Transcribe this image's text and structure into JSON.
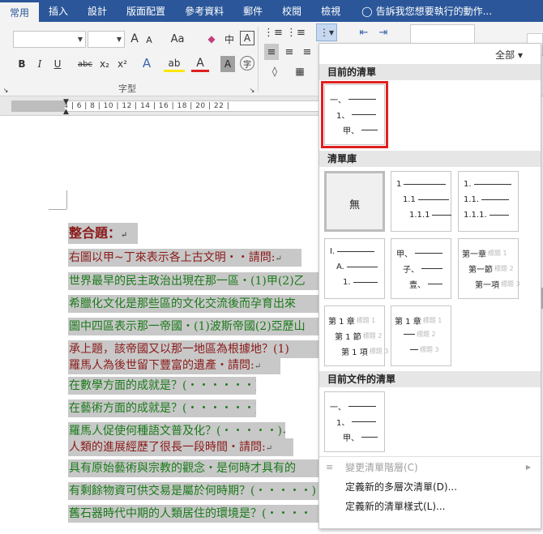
{
  "tabs": [
    "常用",
    "插入",
    "設計",
    "版面配置",
    "參考資料",
    "郵件",
    "校閱",
    "檢視"
  ],
  "tell_me": "告訴我您想要執行的動作...",
  "ribbon": {
    "font_group_label": "字型",
    "grow_font": "A",
    "shrink_font": "A",
    "change_case": "Aa",
    "phonetic": "中",
    "border_char": "A",
    "bold": "B",
    "italic": "I",
    "underline": "U",
    "strike": "abc",
    "sub": "x₂",
    "sup": "x²",
    "char_shade": "A"
  },
  "ruler_text": "| 4 | 2 |   | 2 | 4 | 6 | 8 | 10 | 12 | 14 | 16 | 18 | 20 | 22 |",
  "document": {
    "title": "整合題：",
    "lines": [
      "右圖以甲~丁來表示各上古文明‧‧請問:",
      "世界最早的民主政治出現在那一區‧(1)甲(2)乙",
      "希臘化文化是那些區的文化交流後而孕育出來",
      "圖中四區表示那一帝國‧(1)波斯帝國(2)亞歷山",
      "承上題，該帝國又以那一地區為根據地？(1)",
      "羅馬人為後世留下豐富的遺產‧請問:",
      "在數學方面的成就是？(‧‧‧‧‧‧)",
      "在藝術方面的成就是？(‧‧‧‧‧‧)",
      "羅馬人促使何種語文普及化？(‧‧‧‧‧)",
      "人類的進展經歷了很長一段時間‧請問:",
      "具有原始藝術與宗教的觀念‧是何時才具有的",
      "有剩餘物資可供交易是屬於何時期？(‧‧‧‧‧)",
      "舊石器時代中期的人類居住的環境是？(‧‧‧‧"
    ],
    "paragraph_mark": "↵"
  },
  "panel": {
    "filter_label": "全部 ▾",
    "current_list_header": "目前的清單",
    "library_header": "清單庫",
    "doc_lists_header": "目前文件的清單",
    "none_label": "無",
    "current_list": [
      "一、",
      "1、",
      "甲、"
    ],
    "library": [
      [
        "1",
        "1.1",
        "1.1.1"
      ],
      [
        "1.",
        "1.1.",
        "1.1.1."
      ],
      [
        "I.",
        "A.",
        "1."
      ],
      [
        "甲、",
        "子、",
        "壹、"
      ],
      [
        "第一章",
        "第一節",
        "第一項"
      ],
      [
        "第 1 章",
        "第 1 節",
        "第 1 項"
      ],
      [
        "第 1 章",
        "",
        ""
      ]
    ],
    "heading_faint": "標題 1",
    "heading_faint2": "標題 2",
    "heading_faint3": "標題 3",
    "doc_list": [
      "一、",
      "1、",
      "甲、"
    ],
    "menu": {
      "change_level": "變更清單階層(C)",
      "define_multilevel": "定義新的多層次清單(D)...",
      "define_style": "定義新的清單樣式(L)..."
    }
  }
}
